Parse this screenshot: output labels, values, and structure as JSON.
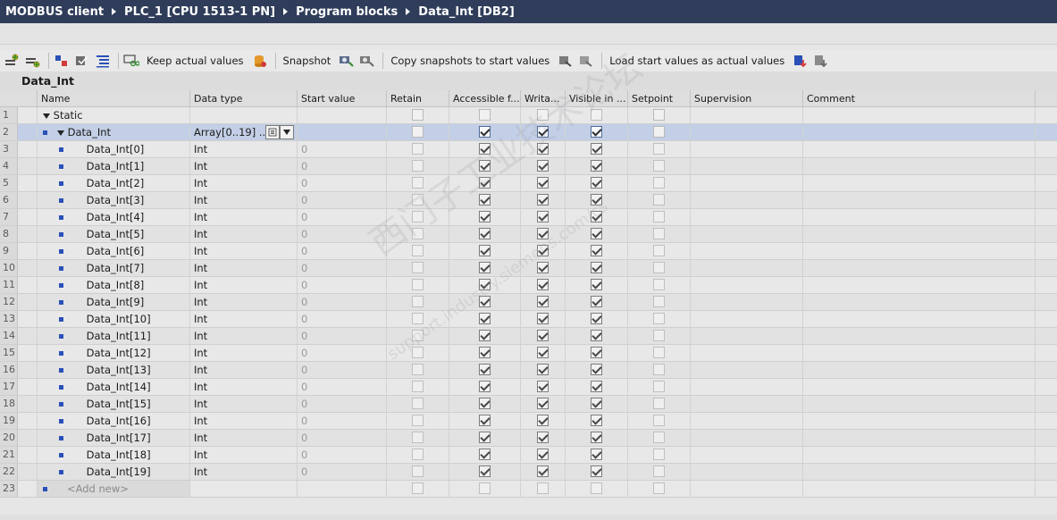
{
  "breadcrumb": [
    "MODBUS client",
    "PLC_1 [CPU 1513-1 PN]",
    "Program blocks",
    "Data_Int [DB2]"
  ],
  "toolbar": {
    "keep_actual_values": "Keep actual values",
    "snapshot": "Snapshot",
    "copy_snapshots": "Copy snapshots to start values",
    "load_start_values": "Load start values as actual values"
  },
  "block_name": "Data_Int",
  "columns": {
    "name": "Name",
    "data_type": "Data type",
    "start_value": "Start value",
    "retain": "Retain",
    "accessible": "Accessible f...",
    "writable": "Writa...",
    "visible": "Visible in ...",
    "setpoint": "Setpoint",
    "supervision": "Supervision",
    "comment": "Comment"
  },
  "rows": [
    {
      "num": "1",
      "name": "Static",
      "type": "",
      "start": "",
      "kind": "section",
      "checks": [
        false,
        false,
        false,
        false,
        false
      ]
    },
    {
      "num": "2",
      "name": "Data_Int",
      "type": "Array[0..19] ...",
      "start": "",
      "kind": "array",
      "checks": [
        false,
        true,
        true,
        true,
        false
      ]
    },
    {
      "num": "3",
      "name": "Data_Int[0]",
      "type": "Int",
      "start": "0",
      "kind": "elem",
      "checks": [
        false,
        true,
        true,
        true,
        false
      ]
    },
    {
      "num": "4",
      "name": "Data_Int[1]",
      "type": "Int",
      "start": "0",
      "kind": "elem",
      "checks": [
        false,
        true,
        true,
        true,
        false
      ]
    },
    {
      "num": "5",
      "name": "Data_Int[2]",
      "type": "Int",
      "start": "0",
      "kind": "elem",
      "checks": [
        false,
        true,
        true,
        true,
        false
      ]
    },
    {
      "num": "6",
      "name": "Data_Int[3]",
      "type": "Int",
      "start": "0",
      "kind": "elem",
      "checks": [
        false,
        true,
        true,
        true,
        false
      ]
    },
    {
      "num": "7",
      "name": "Data_Int[4]",
      "type": "Int",
      "start": "0",
      "kind": "elem",
      "checks": [
        false,
        true,
        true,
        true,
        false
      ]
    },
    {
      "num": "8",
      "name": "Data_Int[5]",
      "type": "Int",
      "start": "0",
      "kind": "elem",
      "checks": [
        false,
        true,
        true,
        true,
        false
      ]
    },
    {
      "num": "9",
      "name": "Data_Int[6]",
      "type": "Int",
      "start": "0",
      "kind": "elem",
      "checks": [
        false,
        true,
        true,
        true,
        false
      ]
    },
    {
      "num": "10",
      "name": "Data_Int[7]",
      "type": "Int",
      "start": "0",
      "kind": "elem",
      "checks": [
        false,
        true,
        true,
        true,
        false
      ]
    },
    {
      "num": "11",
      "name": "Data_Int[8]",
      "type": "Int",
      "start": "0",
      "kind": "elem",
      "checks": [
        false,
        true,
        true,
        true,
        false
      ]
    },
    {
      "num": "12",
      "name": "Data_Int[9]",
      "type": "Int",
      "start": "0",
      "kind": "elem",
      "checks": [
        false,
        true,
        true,
        true,
        false
      ]
    },
    {
      "num": "13",
      "name": "Data_Int[10]",
      "type": "Int",
      "start": "0",
      "kind": "elem",
      "checks": [
        false,
        true,
        true,
        true,
        false
      ]
    },
    {
      "num": "14",
      "name": "Data_Int[11]",
      "type": "Int",
      "start": "0",
      "kind": "elem",
      "checks": [
        false,
        true,
        true,
        true,
        false
      ]
    },
    {
      "num": "15",
      "name": "Data_Int[12]",
      "type": "Int",
      "start": "0",
      "kind": "elem",
      "checks": [
        false,
        true,
        true,
        true,
        false
      ]
    },
    {
      "num": "16",
      "name": "Data_Int[13]",
      "type": "Int",
      "start": "0",
      "kind": "elem",
      "checks": [
        false,
        true,
        true,
        true,
        false
      ]
    },
    {
      "num": "17",
      "name": "Data_Int[14]",
      "type": "Int",
      "start": "0",
      "kind": "elem",
      "checks": [
        false,
        true,
        true,
        true,
        false
      ]
    },
    {
      "num": "18",
      "name": "Data_Int[15]",
      "type": "Int",
      "start": "0",
      "kind": "elem",
      "checks": [
        false,
        true,
        true,
        true,
        false
      ]
    },
    {
      "num": "19",
      "name": "Data_Int[16]",
      "type": "Int",
      "start": "0",
      "kind": "elem",
      "checks": [
        false,
        true,
        true,
        true,
        false
      ]
    },
    {
      "num": "20",
      "name": "Data_Int[17]",
      "type": "Int",
      "start": "0",
      "kind": "elem",
      "checks": [
        false,
        true,
        true,
        true,
        false
      ]
    },
    {
      "num": "21",
      "name": "Data_Int[18]",
      "type": "Int",
      "start": "0",
      "kind": "elem",
      "checks": [
        false,
        true,
        true,
        true,
        false
      ]
    },
    {
      "num": "22",
      "name": "Data_Int[19]",
      "type": "Int",
      "start": "0",
      "kind": "elem",
      "checks": [
        false,
        true,
        true,
        true,
        false
      ]
    },
    {
      "num": "23",
      "name": "<Add new>",
      "type": "",
      "start": "",
      "kind": "add",
      "checks": [
        false,
        false,
        false,
        false,
        false
      ]
    }
  ],
  "watermark": {
    "main": "西门子工业技术论坛",
    "sub": "support.industry.siemens.com/cs"
  },
  "colors": {
    "titlebar": "#2f3d5a",
    "selected_row": "#c3cfe6",
    "member_dot": "#2a50b8"
  }
}
